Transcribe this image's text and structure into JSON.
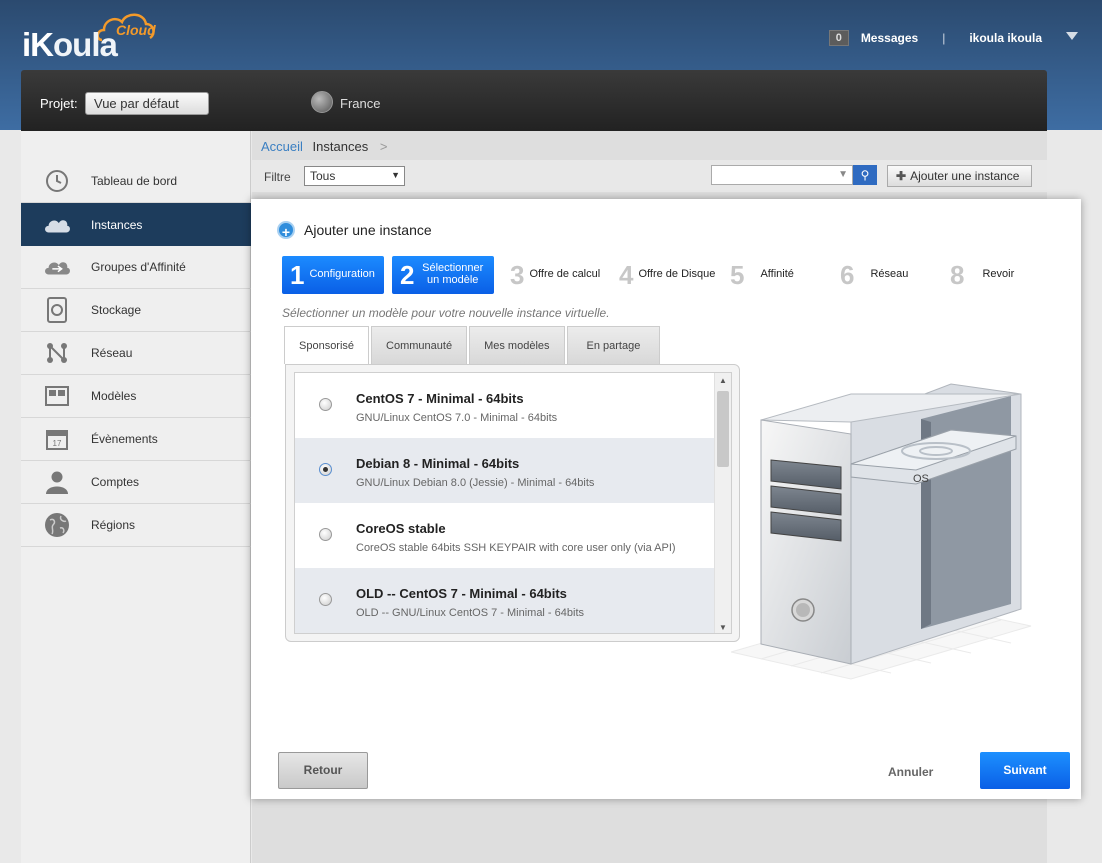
{
  "brand": {
    "name_part1": "iK",
    "name_part2": "oula",
    "cloud": "Cloud"
  },
  "header": {
    "message_count": "0",
    "messages_label": "Messages",
    "separator": "|",
    "user_name": "ikoula ikoula"
  },
  "project": {
    "label": "Projet:",
    "selected": "Vue par défaut",
    "region": "France"
  },
  "sidebar": {
    "items": [
      {
        "label": "Tableau de bord",
        "icon": "dashboard-icon"
      },
      {
        "label": "Instances",
        "icon": "cloud-icon"
      },
      {
        "label": "Groupes d'Affinité",
        "icon": "affinity-icon"
      },
      {
        "label": "Stockage",
        "icon": "storage-icon"
      },
      {
        "label": "Réseau",
        "icon": "network-icon"
      },
      {
        "label": "Modèles",
        "icon": "templates-icon"
      },
      {
        "label": "Évènements",
        "icon": "calendar-icon"
      },
      {
        "label": "Comptes",
        "icon": "user-icon"
      },
      {
        "label": "Régions",
        "icon": "globe-icon"
      }
    ]
  },
  "breadcrumb": {
    "home": "Accueil",
    "current": "Instances",
    "sep": ">"
  },
  "filter": {
    "label": "Filtre",
    "selected": "Tous",
    "add_button": "Ajouter une instance"
  },
  "modal": {
    "title": "Ajouter une instance",
    "steps": [
      {
        "num": "1",
        "label": "Configuration"
      },
      {
        "num": "2",
        "label": "Sélectionner un modèle"
      },
      {
        "num": "3",
        "label": "Offre de calcul"
      },
      {
        "num": "4",
        "label": "Offre de Disque"
      },
      {
        "num": "5",
        "label": "Affinité"
      },
      {
        "num": "6",
        "label": "Réseau"
      },
      {
        "num": "8",
        "label": "Revoir"
      }
    ],
    "subtitle": "Sélectionner un modèle pour votre nouvelle instance virtuelle.",
    "tabs": [
      "Sponsorisé",
      "Communauté",
      "Mes modèles",
      "En partage"
    ],
    "templates": [
      {
        "name": "CentOS 7 - Minimal - 64bits",
        "desc": "GNU/Linux CentOS 7.0 - Minimal - 64bits",
        "checked": false
      },
      {
        "name": "Debian 8 - Minimal - 64bits",
        "desc": "GNU/Linux Debian 8.0 (Jessie) - Minimal - 64bits",
        "checked": true
      },
      {
        "name": "CoreOS stable",
        "desc": "CoreOS stable 64bits SSH KEYPAIR with core user only (via API)",
        "checked": false
      },
      {
        "name": "OLD -- CentOS 7 - Minimal - 64bits",
        "desc": "OLD -- GNU/Linux CentOS 7 - Minimal - 64bits",
        "checked": false
      }
    ],
    "os_label": "OS",
    "back": "Retour",
    "cancel": "Annuler",
    "next": "Suivant"
  }
}
